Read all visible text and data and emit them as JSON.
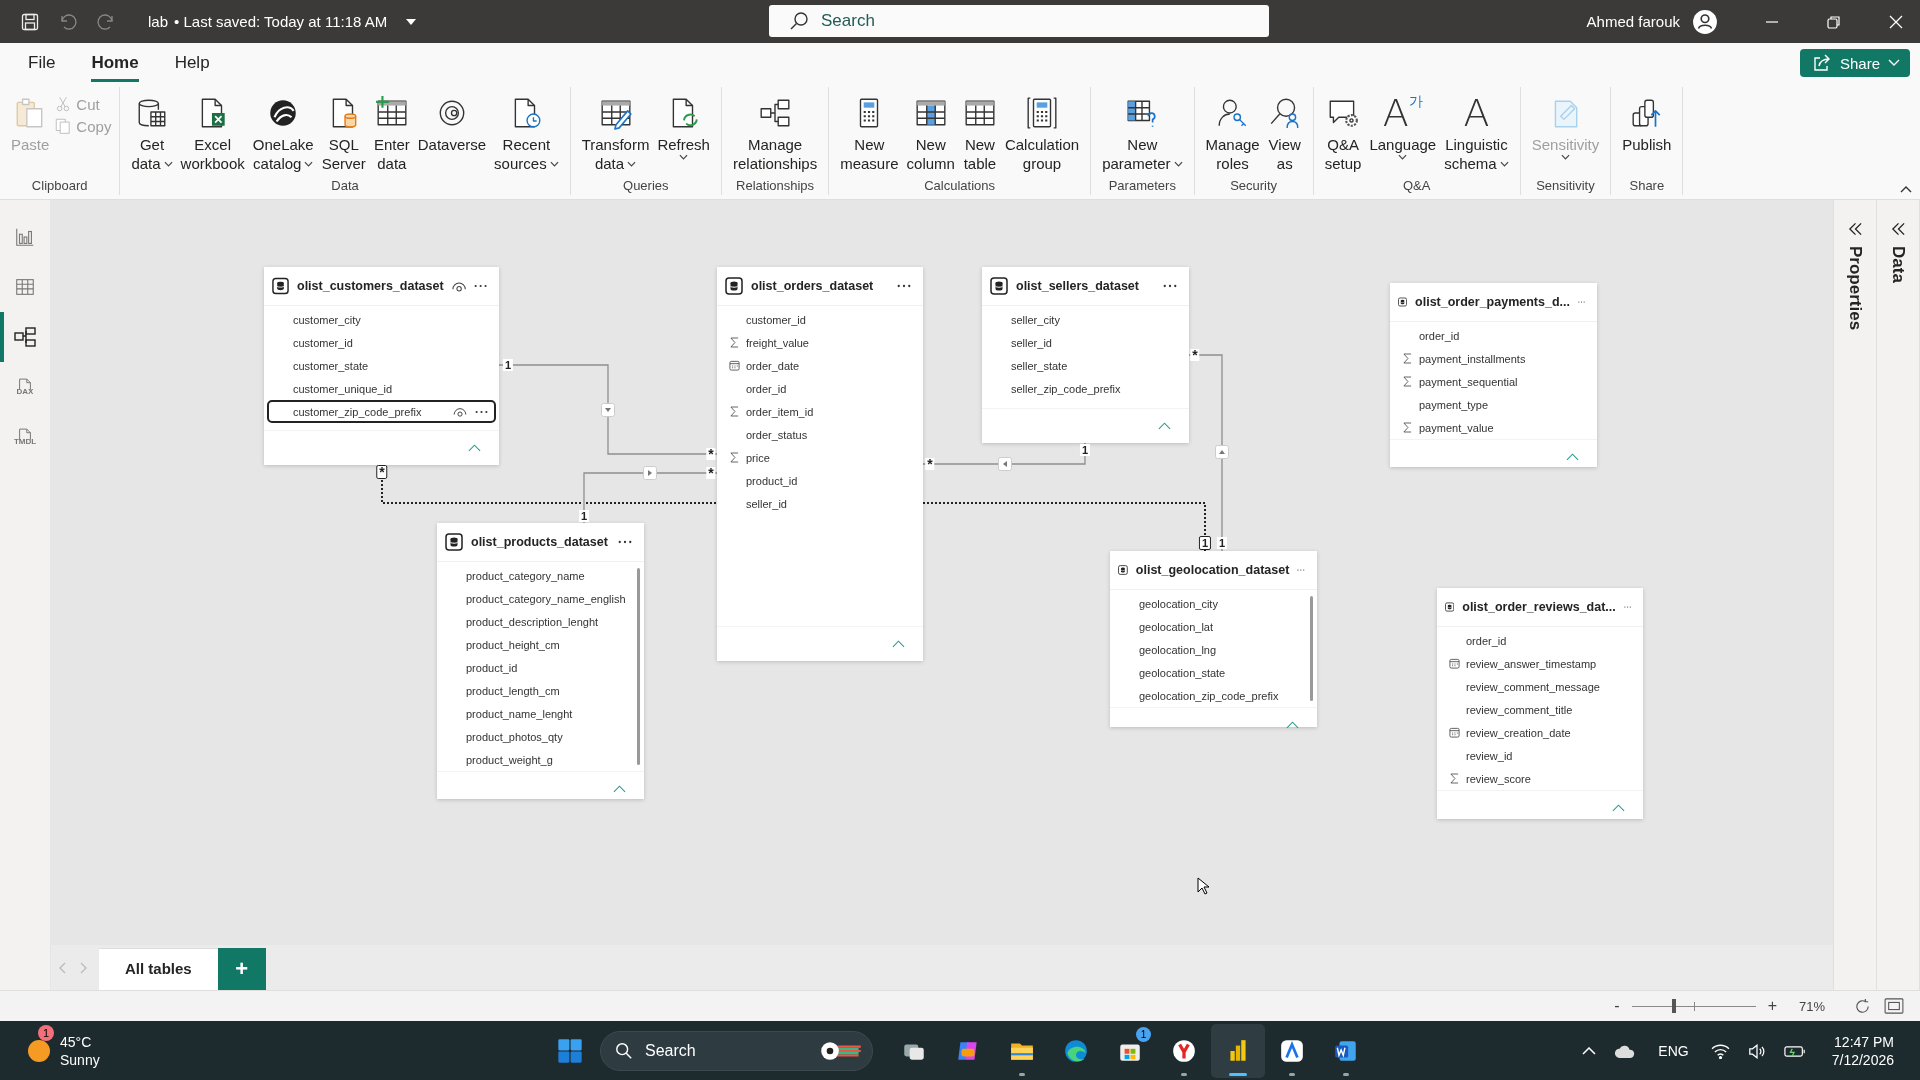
{
  "titlebar": {
    "file_name": "lab",
    "saved": "• Last saved: Today at 11:18 AM",
    "search": {
      "placeholder": "Search"
    },
    "user": "Ahmed farouk"
  },
  "menu_tabs": [
    {
      "label": "File",
      "selected": false
    },
    {
      "label": "Home",
      "selected": true
    },
    {
      "label": "Help",
      "selected": false
    }
  ],
  "share_button": "Share",
  "ribbon": [
    {
      "label": "Clipboard",
      "buttons": [
        {
          "kind": "large",
          "label": [
            "Paste"
          ],
          "dropdown": false,
          "disabled": true
        },
        {
          "kind": "small",
          "label": [
            "Cut"
          ],
          "disabled": true
        },
        {
          "kind": "small",
          "label": [
            "Copy"
          ],
          "disabled": true
        }
      ]
    },
    {
      "label": "Data",
      "buttons": [
        {
          "kind": "large",
          "label": [
            "Get",
            "data"
          ],
          "dropdown": true,
          "disabled": false
        },
        {
          "kind": "large",
          "label": [
            "Excel",
            "workbook"
          ],
          "dropdown": false,
          "disabled": false
        },
        {
          "kind": "large",
          "label": [
            "OneLake",
            "catalog"
          ],
          "dropdown": true,
          "disabled": false
        },
        {
          "kind": "large",
          "label": [
            "SQL",
            "Server"
          ],
          "dropdown": false,
          "disabled": false
        },
        {
          "kind": "large",
          "label": [
            "Enter",
            "data"
          ],
          "dropdown": false,
          "disabled": false
        },
        {
          "kind": "large",
          "label": [
            "Dataverse"
          ],
          "dropdown": false,
          "disabled": false
        },
        {
          "kind": "large",
          "label": [
            "Recent",
            "sources"
          ],
          "dropdown": true,
          "disabled": false
        }
      ]
    },
    {
      "label": "Queries",
      "buttons": [
        {
          "kind": "large",
          "label": [
            "Transform",
            "data"
          ],
          "dropdown": true,
          "disabled": false
        },
        {
          "kind": "large",
          "label": [
            "Refresh"
          ],
          "dropdown": true,
          "disabled": false
        }
      ]
    },
    {
      "label": "Relationships",
      "buttons": [
        {
          "kind": "large",
          "label": [
            "Manage",
            "relationships"
          ],
          "dropdown": false,
          "disabled": false
        }
      ]
    },
    {
      "label": "Calculations",
      "buttons": [
        {
          "kind": "large",
          "label": [
            "New",
            "measure"
          ],
          "dropdown": false,
          "disabled": false
        },
        {
          "kind": "large",
          "label": [
            "New",
            "column"
          ],
          "dropdown": false,
          "disabled": false
        },
        {
          "kind": "large",
          "label": [
            "New",
            "table"
          ],
          "dropdown": false,
          "disabled": false
        },
        {
          "kind": "large",
          "label": [
            "Calculation",
            "group"
          ],
          "dropdown": false,
          "disabled": false
        }
      ]
    },
    {
      "label": "Parameters",
      "buttons": [
        {
          "kind": "large",
          "label": [
            "New",
            "parameter"
          ],
          "dropdown": true,
          "disabled": false
        }
      ]
    },
    {
      "label": "Security",
      "buttons": [
        {
          "kind": "large",
          "label": [
            "Manage",
            "roles"
          ],
          "dropdown": false,
          "disabled": false
        },
        {
          "kind": "large",
          "label": [
            "View",
            "as"
          ],
          "dropdown": false,
          "disabled": false
        }
      ]
    },
    {
      "label": "Q&A",
      "buttons": [
        {
          "kind": "large",
          "label": [
            "Q&A",
            "setup"
          ],
          "dropdown": false,
          "disabled": false
        },
        {
          "kind": "glyph",
          "glyph": "A",
          "glyph_small": "가",
          "label": [
            "Language"
          ],
          "dropdown": true,
          "disabled": false
        },
        {
          "kind": "glyph",
          "glyph": "A",
          "label": [
            "Linguistic",
            "schema"
          ],
          "dropdown": true,
          "disabled": false
        }
      ]
    },
    {
      "label": "Sensitivity",
      "buttons": [
        {
          "kind": "large",
          "label": [
            "Sensitivity"
          ],
          "dropdown": true,
          "disabled": true
        }
      ]
    },
    {
      "label": "Share",
      "buttons": [
        {
          "kind": "large",
          "label": [
            "Publish"
          ],
          "dropdown": false,
          "disabled": false
        }
      ]
    }
  ],
  "views": [
    {
      "selected": false
    },
    {
      "selected": false
    },
    {
      "selected": true
    },
    {
      "selected": false,
      "label": "DAX"
    },
    {
      "selected": false,
      "label": "TMDL"
    }
  ],
  "tables": [
    {
      "name": "olist_customers_dataset",
      "hovered": true,
      "fields": [
        {
          "name": "customer_city",
          "kind": "text",
          "selected": false
        },
        {
          "name": "customer_id",
          "kind": "text",
          "selected": false
        },
        {
          "name": "customer_state",
          "kind": "text",
          "selected": false
        },
        {
          "name": "customer_unique_id",
          "kind": "text",
          "selected": false
        },
        {
          "name": "customer_zip_code_prefix",
          "kind": "text",
          "selected": true
        }
      ]
    },
    {
      "name": "olist_orders_dataset",
      "hovered": false,
      "fields": [
        {
          "name": "customer_id",
          "kind": "text",
          "selected": false
        },
        {
          "name": "freight_value",
          "kind": "sum",
          "selected": false
        },
        {
          "name": "order_date",
          "kind": "date",
          "selected": false
        },
        {
          "name": "order_id",
          "kind": "text",
          "selected": false
        },
        {
          "name": "order_item_id",
          "kind": "sum",
          "selected": false
        },
        {
          "name": "order_status",
          "kind": "text",
          "selected": false
        },
        {
          "name": "price",
          "kind": "sum",
          "selected": false
        },
        {
          "name": "product_id",
          "kind": "text",
          "selected": false
        },
        {
          "name": "seller_id",
          "kind": "text",
          "selected": false
        }
      ]
    },
    {
      "name": "olist_sellers_dataset",
      "hovered": false,
      "fields": [
        {
          "name": "seller_city",
          "kind": "text",
          "selected": false
        },
        {
          "name": "seller_id",
          "kind": "text",
          "selected": false
        },
        {
          "name": "seller_state",
          "kind": "text",
          "selected": false
        },
        {
          "name": "seller_zip_code_prefix",
          "kind": "text",
          "selected": false
        }
      ]
    },
    {
      "name": "olist_order_payments_d...",
      "hovered": false,
      "fields": [
        {
          "name": "order_id",
          "kind": "text",
          "selected": false
        },
        {
          "name": "payment_installments",
          "kind": "sum",
          "selected": false
        },
        {
          "name": "payment_sequential",
          "kind": "sum",
          "selected": false
        },
        {
          "name": "payment_type",
          "kind": "text",
          "selected": false
        },
        {
          "name": "payment_value",
          "kind": "sum",
          "selected": false
        }
      ]
    },
    {
      "name": "olist_products_dataset",
      "hovered": false,
      "fields": [
        {
          "name": "product_category_name",
          "kind": "text",
          "selected": false
        },
        {
          "name": "product_category_name_english",
          "kind": "text",
          "selected": false
        },
        {
          "name": "product_description_lenght",
          "kind": "text",
          "selected": false
        },
        {
          "name": "product_height_cm",
          "kind": "text",
          "selected": false
        },
        {
          "name": "product_id",
          "kind": "text",
          "selected": false
        },
        {
          "name": "product_length_cm",
          "kind": "text",
          "selected": false
        },
        {
          "name": "product_name_lenght",
          "kind": "text",
          "selected": false
        },
        {
          "name": "product_photos_qty",
          "kind": "text",
          "selected": false
        },
        {
          "name": "product_weight_g",
          "kind": "text",
          "selected": false
        }
      ]
    },
    {
      "name": "olist_geolocation_dataset",
      "hovered": false,
      "fields": [
        {
          "name": "geolocation_city",
          "kind": "text",
          "selected": false
        },
        {
          "name": "geolocation_lat",
          "kind": "text",
          "selected": false
        },
        {
          "name": "geolocation_lng",
          "kind": "text",
          "selected": false
        },
        {
          "name": "geolocation_state",
          "kind": "text",
          "selected": false
        },
        {
          "name": "geolocation_zip_code_prefix",
          "kind": "text",
          "selected": false
        }
      ]
    },
    {
      "name": "olist_order_reviews_dat...",
      "hovered": false,
      "fields": [
        {
          "name": "order_id",
          "kind": "text",
          "selected": false
        },
        {
          "name": "review_answer_timestamp",
          "kind": "date",
          "selected": false
        },
        {
          "name": "review_comment_message",
          "kind": "text",
          "selected": false
        },
        {
          "name": "review_comment_title",
          "kind": "text",
          "selected": false
        },
        {
          "name": "review_creation_date",
          "kind": "date",
          "selected": false
        },
        {
          "name": "review_id",
          "kind": "text",
          "selected": false
        },
        {
          "name": "review_score",
          "kind": "sum",
          "selected": false
        }
      ]
    }
  ],
  "relationships": [
    {
      "one_label": "1",
      "many_label": "*",
      "active": true,
      "selected": false
    },
    {
      "one_label": "1",
      "many_label": "*",
      "active": true,
      "selected": false
    },
    {
      "one_label": "1",
      "many_label": "*",
      "active": true,
      "selected": false
    },
    {
      "one_label": "1",
      "many_label": "*",
      "active": true,
      "selected": false
    },
    {
      "one_label": "1",
      "many_label": "*",
      "active": false,
      "selected": true
    }
  ],
  "side_panes": [
    "Properties",
    "Data"
  ],
  "page_tabs": [
    {
      "label": "All tables",
      "selected": true
    }
  ],
  "add_page": "+",
  "status_bar": {
    "zoom_out": "-",
    "zoom_in": "+",
    "zoom": {
      "level": 0.34
    },
    "zoom_reading": "71%"
  },
  "taskbar": {
    "weather": {
      "badge": "1",
      "temperature": "45°C",
      "condition": "Sunny"
    },
    "search": {
      "placeholder": "Search"
    },
    "apps": [
      {
        "running": false,
        "active": false
      },
      {
        "running": false,
        "active": false
      },
      {
        "running": true,
        "active": false
      },
      {
        "running": false,
        "active": false
      },
      {
        "running": false,
        "active": false,
        "badge": "1"
      },
      {
        "running": true,
        "active": false
      },
      {
        "running": true,
        "active": true
      },
      {
        "running": true,
        "active": false
      },
      {
        "running": true,
        "active": false
      }
    ],
    "language": "ENG",
    "time": "12:47 PM",
    "date": "7/12/2026"
  }
}
